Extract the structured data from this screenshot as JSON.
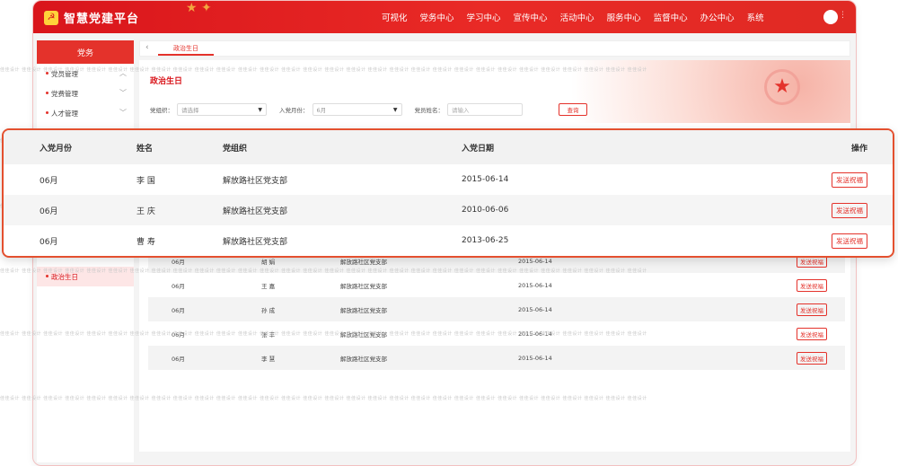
{
  "app": {
    "brand_name": "智慧党建平台",
    "brand_logo_glyph": "☭",
    "nav": [
      "可视化",
      "党务中心",
      "学习中心",
      "宣传中心",
      "活动中心",
      "服务中心",
      "监督中心",
      "办公中心",
      "系统"
    ],
    "colors": {
      "primary": "#e4322b",
      "header": "#d9151b",
      "gold": "#f7c948"
    }
  },
  "sidebar": {
    "title": "党务",
    "items": [
      {
        "label": "党员管理",
        "chevron": "︿"
      },
      {
        "label": "党费管理",
        "chevron": "﹀"
      },
      {
        "label": "人才管理",
        "chevron": "﹀"
      }
    ],
    "active_item": "政治生日"
  },
  "tabs": {
    "back_icon": "‹",
    "active_tab": "政治生日"
  },
  "page": {
    "title": "政治生日",
    "filters": {
      "org_label": "党组织：",
      "org_placeholder": "请选择",
      "month_label": "入党月份：",
      "month_value": "6月",
      "name_label": "党员姓名：",
      "name_placeholder": "请输入",
      "query_button": "查询"
    }
  },
  "table": {
    "columns": [
      "入党月份",
      "姓名",
      "党组织",
      "入党日期",
      "操作"
    ],
    "action_label": "发送祝福",
    "zoom_rows": [
      {
        "month": "06月",
        "name": "李  国",
        "org": "解放路社区党支部",
        "date": "2015-06-14"
      },
      {
        "month": "06月",
        "name": "王  庆",
        "org": "解放路社区党支部",
        "date": "2010-06-06"
      },
      {
        "month": "06月",
        "name": "曹  寿",
        "org": "解放路社区党支部",
        "date": "2013-06-25"
      }
    ],
    "rows": [
      {
        "month": "06月",
        "name": "胡  娟",
        "org": "解放路社区党支部",
        "date": "2015-06-14"
      },
      {
        "month": "06月",
        "name": "王  嘉",
        "org": "解放路社区党支部",
        "date": "2015-06-14"
      },
      {
        "month": "06月",
        "name": "孙  成",
        "org": "解放路社区党支部",
        "date": "2015-06-14"
      },
      {
        "month": "06月",
        "name": "张  丰",
        "org": "解放路社区党支部",
        "date": "2015-06-14"
      },
      {
        "month": "06月",
        "name": "李  慧",
        "org": "解放路社区党支部",
        "date": "2015-06-14"
      }
    ]
  },
  "watermark": "佳佳设计"
}
